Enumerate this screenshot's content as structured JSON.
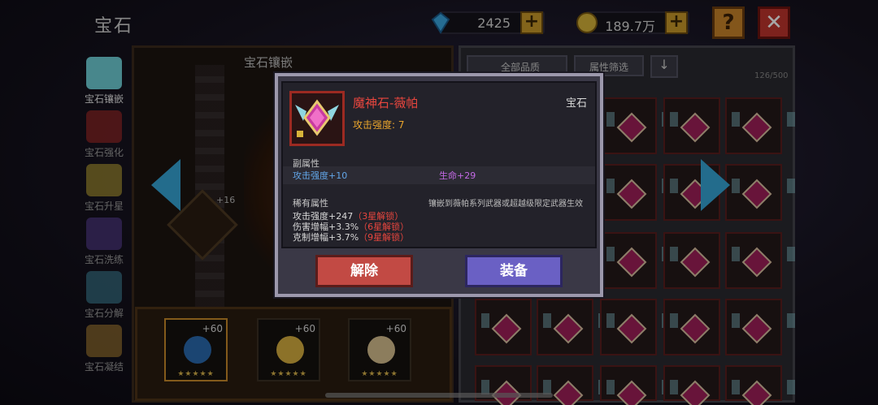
{
  "header": {
    "title": "宝石",
    "gems": "2425",
    "gold": "189.7万",
    "plus": "+",
    "help": "?",
    "close": "✕"
  },
  "sidebar": {
    "items": [
      {
        "label": "宝石镶嵌",
        "color": "#6fd0d8"
      },
      {
        "label": "宝石强化",
        "color": "#c8302a"
      },
      {
        "label": "宝石升星",
        "color": "#e0c43a"
      },
      {
        "label": "宝石洗练",
        "color": "#6a4ab0"
      },
      {
        "label": "宝石分解",
        "color": "#4aa0b8"
      },
      {
        "label": "宝石凝结",
        "color": "#d09a3a"
      }
    ]
  },
  "middle": {
    "title": "宝石镶嵌",
    "center_bonus": "+16",
    "slots": [
      {
        "bonus": "+60",
        "stars": "★★★★★",
        "color": "#2a6ab0"
      },
      {
        "bonus": "+60",
        "stars": "★★★★★",
        "color": "#d8b040"
      },
      {
        "bonus": "+60",
        "stars": "★★★★★",
        "color": "#d8c090"
      }
    ]
  },
  "inventory": {
    "filter_quality": "全部品质",
    "filter_attr": "属性筛选",
    "sort_icon": "↓",
    "count": "126/500"
  },
  "popup": {
    "name": "魔神石-薇帕",
    "type": "宝石",
    "attack": "攻击强度: 7",
    "sub_title": "副属性",
    "sub_attrs": [
      "攻击强度+10",
      "生命+29"
    ],
    "rare_title": "稀有属性",
    "rare_note": "镶嵌到薇帕系列武器或超越级限定武器生效",
    "rare_attrs": [
      {
        "text": "攻击强度+247",
        "lock": "（3星解锁）"
      },
      {
        "text": "伤害增幅+3.3%",
        "lock": "（6星解锁）"
      },
      {
        "text": "克制增幅+3.7%",
        "lock": "（9星解锁）"
      }
    ],
    "unequip": "解除",
    "equip": "装备"
  },
  "colors": {
    "accent_blue": "#36a6d8",
    "rare_red": "#e8463e",
    "equip_purple": "#6a60c4",
    "unequip_red": "#c24a44"
  }
}
